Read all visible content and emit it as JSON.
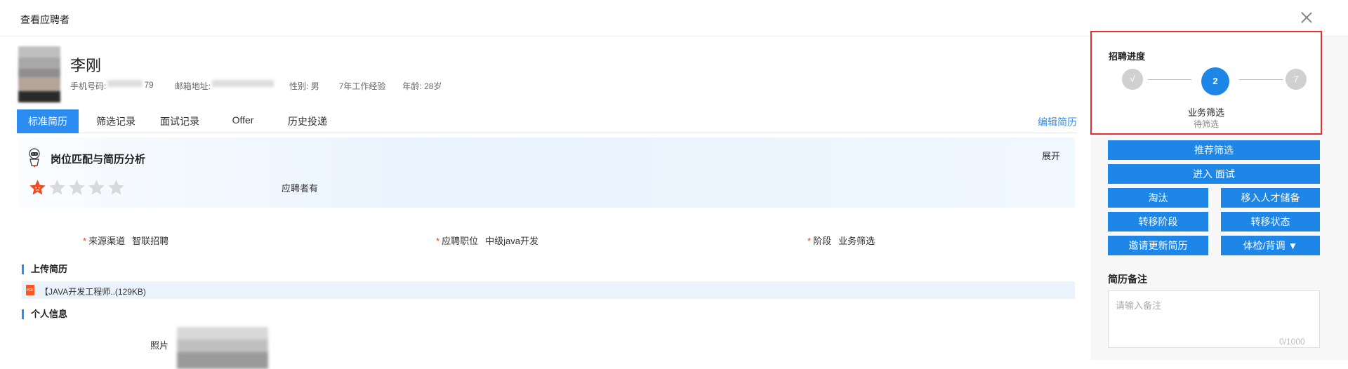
{
  "modal": {
    "title": "查看应聘者"
  },
  "candidate": {
    "name": "李刚",
    "phone_label": "手机号码:",
    "phone_tail": "79",
    "email_label": "邮箱地址:",
    "gender": "性别: 男",
    "experience": "7年工作经验",
    "age": "年龄: 28岁"
  },
  "tabs": [
    {
      "label": "标准简历"
    },
    {
      "label": "筛选记录"
    },
    {
      "label": "面试记录"
    },
    {
      "label": "Offer"
    },
    {
      "label": "历史投递"
    }
  ],
  "edit_resume": "编辑简历",
  "analysis": {
    "title": "岗位匹配与简历分析",
    "expand": "展开",
    "rating": 1,
    "rating_max": 5,
    "applicant_has": "应聘者有"
  },
  "fields": {
    "source": {
      "label": "来源渠道",
      "value": "智联招聘"
    },
    "position": {
      "label": "应聘职位",
      "value": "中级java开发"
    },
    "stage": {
      "label": "阶段",
      "value": "业务筛选"
    }
  },
  "uploaded": {
    "title": "上传简历",
    "file_name": "【JAVA开发工程师..(129KB)"
  },
  "personal": {
    "title": "个人信息",
    "photo_label": "照片"
  },
  "progress": {
    "title": "招聘进度",
    "steps": [
      {
        "label": "√"
      },
      {
        "label": "2"
      },
      {
        "label": "7"
      }
    ],
    "current_name": "业务筛选",
    "current_status": "待筛选"
  },
  "actions": {
    "recommend": "推荐筛选",
    "interview": "进入 面试",
    "eliminate": "淘汰",
    "talent_pool": "移入人才储备",
    "transfer_stage": "转移阶段",
    "transfer_status": "转移状态",
    "invite_update": "邀请更新简历",
    "checkup": "体检/背调 ▼"
  },
  "notes": {
    "title": "简历备注",
    "placeholder": "请输入备注",
    "counter": "0/1000"
  },
  "colors": {
    "primary": "#1e86e6",
    "tab_active": "#2d8cf0",
    "highlight_border": "#e5302e",
    "required": "#ed4014",
    "star_active": "#f04a20",
    "star_inactive": "#d9d9d9"
  }
}
